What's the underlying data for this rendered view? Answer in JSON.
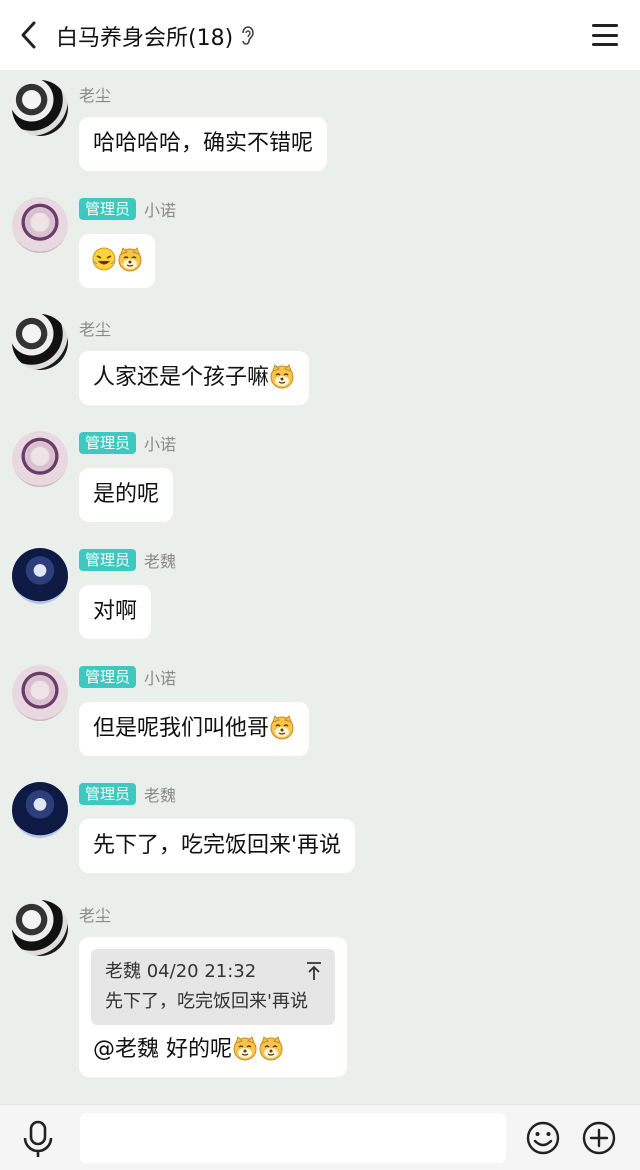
{
  "header": {
    "title": "白马养身会所(18)",
    "back_icon": "chevron-left-icon",
    "ear_icon": "ear-icon",
    "menu_icon": "hamburger-menu-icon"
  },
  "messages": [
    {
      "sender": "老尘",
      "badge": "",
      "text": "哈哈哈哈，确实不错呢"
    },
    {
      "sender": "小诺",
      "badge": "管理员",
      "text": ""
    },
    {
      "sender": "老尘",
      "badge": "",
      "text": "人家还是个孩子嘛"
    },
    {
      "sender": "小诺",
      "badge": "管理员",
      "text": "是的呢"
    },
    {
      "sender": "老魏",
      "badge": "管理员",
      "text": "对啊"
    },
    {
      "sender": "小诺",
      "badge": "管理员",
      "text": "但是呢我们叫他哥"
    },
    {
      "sender": "老魏",
      "badge": "管理员",
      "text": "先下了，吃完饭回来'再说"
    },
    {
      "sender": "老尘",
      "badge": "",
      "text": "@老魏 好的呢",
      "quote": {
        "header": "老魏 04/20 21:32",
        "text": "先下了，吃完饭回来'再说"
      }
    }
  ],
  "input": {
    "placeholder": "",
    "value": ""
  },
  "colors": {
    "badge": "#3ec8c0",
    "background": "#ebefec",
    "bubble": "#ffffff"
  },
  "icons": {
    "mic": "microphone-icon",
    "emoji": "smiley-icon",
    "add": "plus-circle-icon"
  }
}
